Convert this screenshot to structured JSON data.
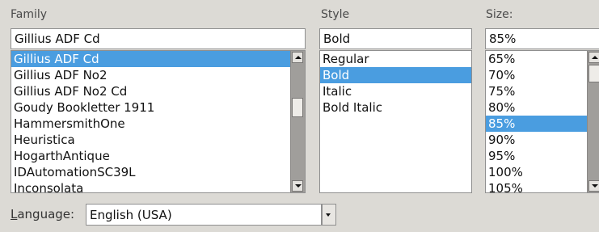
{
  "family": {
    "header": "Family",
    "value": "Gillius ADF Cd",
    "items": [
      "Gillius ADF Cd",
      "Gillius ADF No2",
      "Gillius ADF No2 Cd",
      "Goudy Bookletter 1911",
      "HammersmithOne",
      "Heuristica",
      "HogarthAntique",
      "IDAutomationSC39L",
      "Inconsolata"
    ],
    "selected_index": 0
  },
  "style": {
    "header": "Style",
    "value": "Bold",
    "items": [
      "Regular",
      "Bold",
      "Italic",
      "Bold Italic"
    ],
    "selected_index": 1
  },
  "size": {
    "header": "Size:",
    "value": "85%",
    "items": [
      "65%",
      "70%",
      "75%",
      "80%",
      "85%",
      "90%",
      "95%",
      "100%",
      "105%"
    ],
    "selected_index": 4
  },
  "language": {
    "label_prefix": "",
    "label_accel": "L",
    "label_rest": "anguage:",
    "value": "English (USA)"
  },
  "colors": {
    "selection": "#4a9de0",
    "background": "#dcdad5"
  }
}
